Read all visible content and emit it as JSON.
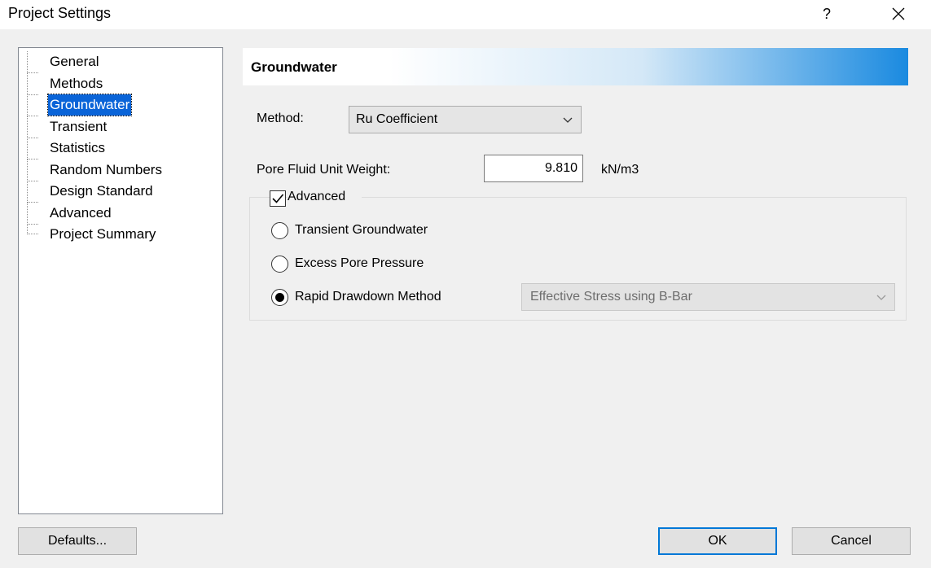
{
  "window": {
    "title": "Project Settings",
    "help_label": "?"
  },
  "tree": {
    "items": [
      {
        "label": "General",
        "selected": false
      },
      {
        "label": "Methods",
        "selected": false
      },
      {
        "label": "Groundwater",
        "selected": true
      },
      {
        "label": "Transient",
        "selected": false
      },
      {
        "label": "Statistics",
        "selected": false
      },
      {
        "label": "Random Numbers",
        "selected": false
      },
      {
        "label": "Design Standard",
        "selected": false
      },
      {
        "label": "Advanced",
        "selected": false
      },
      {
        "label": "Project Summary",
        "selected": false
      }
    ]
  },
  "panel": {
    "header": "Groundwater",
    "method_label": "Method:",
    "method_value": "Ru Coefficient",
    "unit_weight_label": "Pore Fluid Unit Weight:",
    "unit_weight_value": "9.810",
    "unit_weight_units": "kN/m3",
    "advanced_label": "Advanced",
    "advanced_checked": true,
    "radio_transient": "Transient Groundwater",
    "radio_excess": "Excess Pore Pressure",
    "radio_rapid": "Rapid Drawdown Method",
    "selected_radio": "rapid",
    "rapid_method_value": "Effective Stress using B-Bar"
  },
  "buttons": {
    "defaults": "Defaults...",
    "ok": "OK",
    "cancel": "Cancel"
  },
  "colors": {
    "selection": "#0a64d8",
    "header_gradient_end": "#1a8ae0",
    "default_button_border": "#0078d7"
  }
}
